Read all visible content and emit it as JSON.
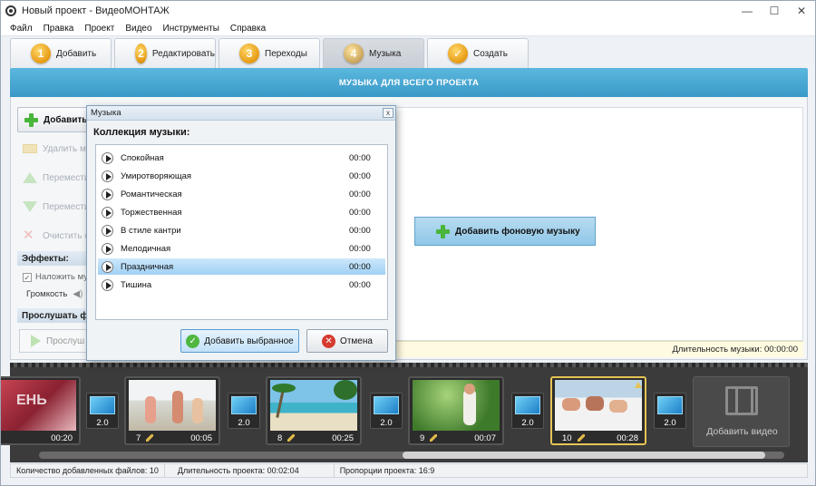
{
  "window": {
    "title": "Новый проект - ВидеоМОНТАЖ"
  },
  "menu": [
    "Файл",
    "Правка",
    "Проект",
    "Видео",
    "Инструменты",
    "Справка"
  ],
  "tabs": [
    {
      "num": "1",
      "label": "Добавить"
    },
    {
      "num": "2",
      "label": "Редактировать"
    },
    {
      "num": "3",
      "label": "Переходы"
    },
    {
      "num": "4",
      "label": "Музыка"
    },
    {
      "num": "✓",
      "label": "Создать"
    }
  ],
  "band_title": "МУЗЫКА ДЛЯ ВСЕГО ПРОЕКТА",
  "sidebar": {
    "add": "Добавить",
    "delete": "Удалить му",
    "move_up": "Перемести",
    "move_down": "Перемести",
    "clear": "Очистить с",
    "effects_header": "Эффекты:",
    "overlay_check": "Наложить му",
    "volume": "Громкость",
    "listen_header": "Прослушать ф",
    "listen_btn": "Прослуш"
  },
  "main": {
    "add_bg_music": "Добавить фоновую музыку",
    "music_duration": "Длительность музыки: 00:00:00"
  },
  "dialog": {
    "title": "Музыка",
    "close": "x",
    "heading": "Коллекция музыки:",
    "items": [
      {
        "name": "Спокойная",
        "time": "00:00"
      },
      {
        "name": "Умиротворяющая",
        "time": "00:00"
      },
      {
        "name": "Романтическая",
        "time": "00:00"
      },
      {
        "name": "Торжественная",
        "time": "00:00"
      },
      {
        "name": "В стиле кантри",
        "time": "00:00"
      },
      {
        "name": "Мелодичная",
        "time": "00:00"
      },
      {
        "name": "Праздничная",
        "time": "00:00"
      },
      {
        "name": "Тишина",
        "time": "00:00"
      }
    ],
    "selected_index": 6,
    "ok": "Добавить выбранное",
    "cancel": "Отмена"
  },
  "timeline": {
    "clips": [
      {
        "num": "",
        "duration": "00:20"
      },
      {
        "num": "7",
        "duration": "00:05"
      },
      {
        "num": "8",
        "duration": "00:25"
      },
      {
        "num": "9",
        "duration": "00:07"
      },
      {
        "num": "10",
        "duration": "00:28"
      }
    ],
    "transitions": [
      "2.0",
      "2.0",
      "2.0",
      "2.0",
      "2.0"
    ],
    "add_video": "Добавить видео"
  },
  "status": {
    "files": "Количество добавленных файлов: 10",
    "duration": "Длительность проекта: 00:02:04",
    "aspect": "Пропорции проекта: 16:9"
  }
}
